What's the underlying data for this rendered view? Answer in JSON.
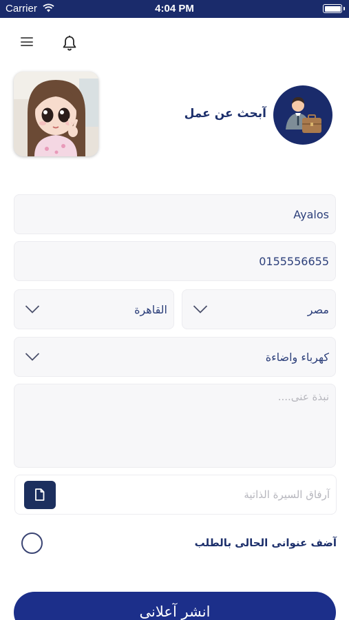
{
  "status_bar": {
    "carrier": "Carrier",
    "time": "4:04 PM"
  },
  "header": {
    "menu_icon": "hamburger-menu-icon",
    "notification_icon": "bell-icon"
  },
  "profile": {
    "avatar": "user-avatar-cartoon-girl",
    "job_icon": "job-seeker-briefcase-icon",
    "title": "آبحث عن عمل"
  },
  "form": {
    "name": {
      "value": "Ayalos"
    },
    "phone": {
      "value": "0155556655"
    },
    "country": {
      "value": "مصر"
    },
    "city": {
      "value": "القاهرة"
    },
    "category": {
      "value": "كهرباء واضاءة"
    },
    "bio": {
      "placeholder": "نبذة عنى...."
    },
    "cv": {
      "placeholder": "آرفاق السيرة الذاتية",
      "icon": "file-icon"
    },
    "add_address": {
      "label": "آضف عنوانى الحالى بالطلب",
      "checked": false
    }
  },
  "submit": {
    "label": "انشر آعلانى"
  },
  "colors": {
    "primary": "#1a2b6b",
    "button": "#1c2f8a",
    "field_bg": "#f7f7f9",
    "placeholder": "#b6b6bd"
  }
}
